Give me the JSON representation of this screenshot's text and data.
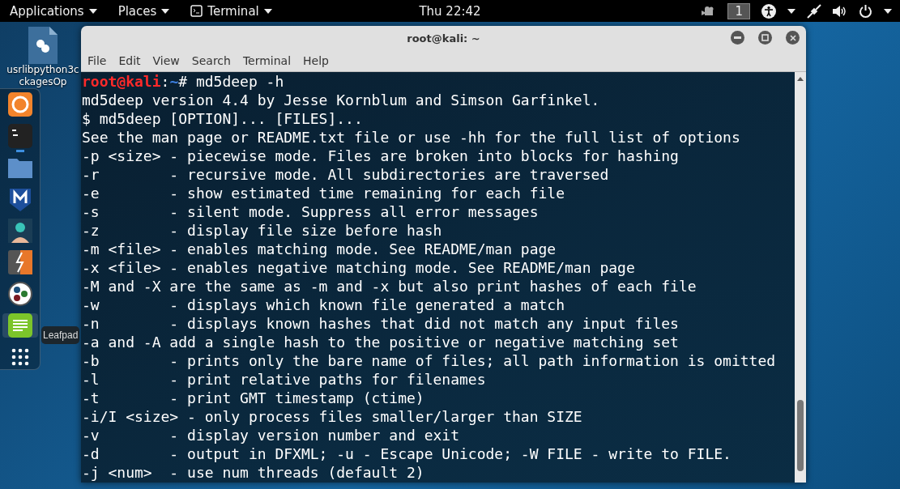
{
  "top_bar": {
    "menus": [
      {
        "label": "Applications",
        "kind": "plain"
      },
      {
        "label": "Places",
        "kind": "plain"
      },
      {
        "label": "Terminal",
        "kind": "terminal"
      }
    ],
    "clock": "Thu 22:42",
    "workspace": "1"
  },
  "desktop_icon": {
    "label_lines": [
      "usrlibpython3c",
      "ckagesOp"
    ]
  },
  "dock": {
    "items": [
      {
        "kind": "firefox",
        "running": false,
        "hovered": false
      },
      {
        "kind": "terminal",
        "running": true,
        "hovered": false
      },
      {
        "kind": "folder",
        "running": false,
        "hovered": false
      },
      {
        "kind": "shield",
        "running": false,
        "hovered": false
      },
      {
        "kind": "person",
        "running": false,
        "hovered": false
      },
      {
        "kind": "bolt",
        "running": false,
        "hovered": false
      },
      {
        "kind": "dots",
        "running": false,
        "hovered": false
      },
      {
        "kind": "notepad",
        "running": false,
        "hovered": true
      },
      {
        "kind": "grid",
        "running": false,
        "hovered": false
      }
    ],
    "tooltip": "Leafpad"
  },
  "window": {
    "title": "root@kali: ~",
    "menu": [
      "File",
      "Edit",
      "View",
      "Search",
      "Terminal",
      "Help"
    ],
    "prompt": {
      "user": "root@kali",
      "separator": ":",
      "path": "~",
      "symbol": "#",
      "command": " md5deep -h"
    },
    "output": [
      "md5deep version 4.4 by Jesse Kornblum and Simson Garfinkel.",
      "$ md5deep [OPTION]... [FILES]...",
      "See the man page or README.txt file or use -hh for the full list of options",
      "-p <size> - piecewise mode. Files are broken into blocks for hashing",
      "-r        - recursive mode. All subdirectories are traversed",
      "-e        - show estimated time remaining for each file",
      "-s        - silent mode. Suppress all error messages",
      "-z        - display file size before hash",
      "-m <file> - enables matching mode. See README/man page",
      "-x <file> - enables negative matching mode. See README/man page",
      "-M and -X are the same as -m and -x but also print hashes of each file",
      "-w        - displays which known file generated a match",
      "-n        - displays known hashes that did not match any input files",
      "-a and -A add a single hash to the positive or negative matching set",
      "-b        - prints only the bare name of files; all path information is omitted",
      "-l        - print relative paths for filenames",
      "-t        - print GMT timestamp (ctime)",
      "-i/I <size> - only process files smaller/larger than SIZE",
      "-v        - display version number and exit",
      "-d        - output in DFXML; -u - Escape Unicode; -W FILE - write to FILE.",
      "-j <num>  - use num threads (default 2)"
    ]
  }
}
